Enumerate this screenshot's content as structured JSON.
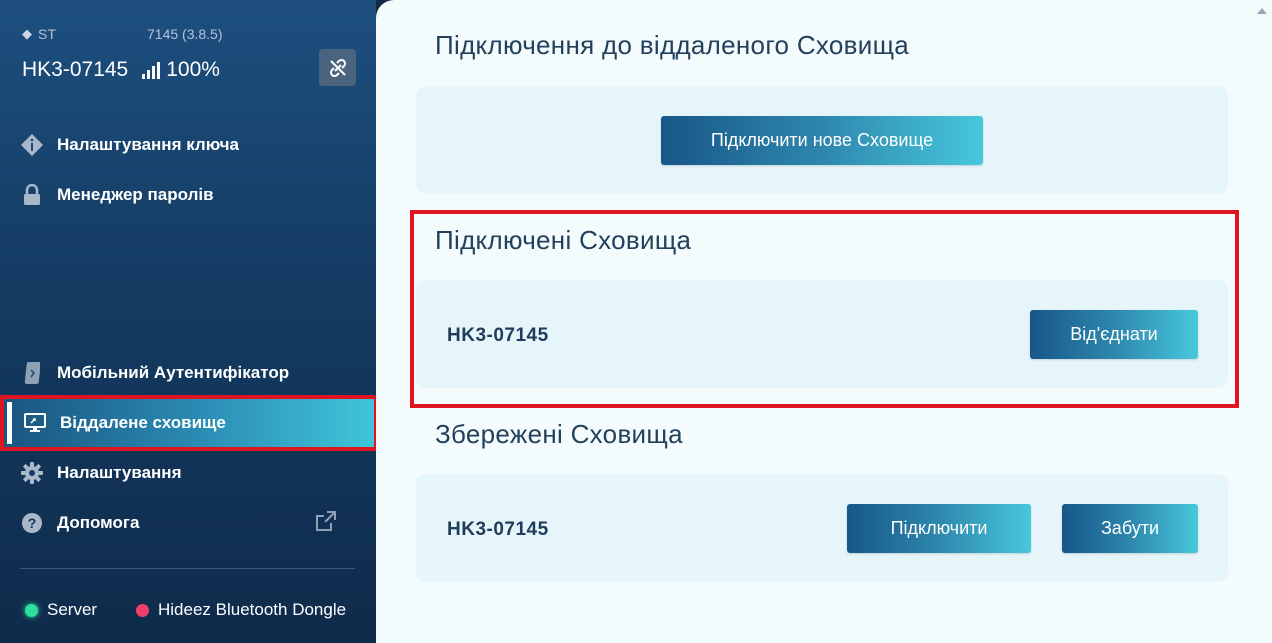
{
  "sidebar": {
    "device_type": "ST",
    "device_version": "7145 (3.8.5)",
    "device_name": "HK3-07145",
    "battery": "100%",
    "nav_top": [
      {
        "label": "Налаштування ключа",
        "icon": "key-info-icon"
      },
      {
        "label": "Менеджер паролів",
        "icon": "lock-icon"
      }
    ],
    "nav_bottom": [
      {
        "label": "Мобільний Аутентифікатор",
        "icon": "mobile-icon"
      },
      {
        "label": "Віддалене сховище",
        "icon": "remote-monitor-icon",
        "active": true
      },
      {
        "label": "Налаштування",
        "icon": "gear-icon"
      },
      {
        "label": "Допомога",
        "icon": "help-icon"
      }
    ],
    "status": [
      {
        "label": "Server",
        "color": "#2ee0a0"
      },
      {
        "label": "Hideez Bluetooth Dongle",
        "color": "#f0406a"
      }
    ]
  },
  "main": {
    "connect_section": {
      "title": "Підключення до віддаленого Сховища",
      "button": "Підключити нове Сховище"
    },
    "connected_section": {
      "title": "Підключені Сховища",
      "vault_name": "HK3-07145",
      "disconnect_button": "Від'єднати"
    },
    "saved_section": {
      "title": "Збережені Сховища",
      "vault_name": "HK3-07145",
      "connect_button": "Підключити",
      "forget_button": "Забути"
    }
  },
  "colors": {
    "accent_start": "#175789",
    "accent_end": "#47c8dc",
    "highlight": "#e0141e"
  }
}
